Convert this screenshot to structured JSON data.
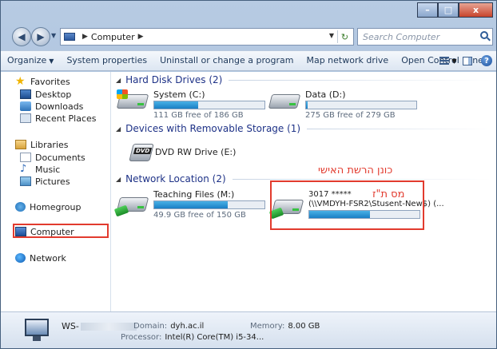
{
  "window": {
    "caption": {
      "minimize": "–",
      "maximize": "□",
      "close": "x"
    }
  },
  "address": {
    "path": [
      "Computer"
    ],
    "search_placeholder": "Search Computer"
  },
  "toolbar": {
    "organize": "Organize",
    "system_properties": "System properties",
    "uninstall": "Uninstall or change a program",
    "map_drive": "Map network drive",
    "control_panel": "Open Control Panel"
  },
  "nav": {
    "favorites": "Favorites",
    "desktop": "Desktop",
    "downloads": "Downloads",
    "recent": "Recent Places",
    "libraries": "Libraries",
    "documents": "Documents",
    "music": "Music",
    "pictures": "Pictures",
    "homegroup": "Homegroup",
    "computer": "Computer",
    "network": "Network"
  },
  "groups": {
    "hdd": "Hard Disk Drives (2)",
    "removable": "Devices with Removable Storage (1)",
    "network": "Network Location (2)"
  },
  "drives": {
    "system": {
      "name": "System (C:)",
      "free": "111 GB free of 186 GB",
      "used_fraction": 0.4
    },
    "data": {
      "name": "Data (D:)",
      "free": "275 GB free of 279 GB",
      "used_fraction": 0.015
    },
    "dvd": {
      "name": "DVD RW Drive (E:)",
      "badge": "DVD"
    },
    "teaching": {
      "name": "Teaching Files (M:)",
      "free": "49.9 GB free of 150 GB",
      "used_fraction": 0.67
    },
    "personal": {
      "line1": "3017 ***** ",
      "line2": "(\\\\VMDYH-FSR2\\Stusent-New$) (...",
      "used_fraction": 0.55
    }
  },
  "annotations": {
    "personal_drive": "כונן הרשת האישי",
    "id_number": "מס ת\"ז"
  },
  "details": {
    "name": "WS-",
    "domain_label": "Domain:",
    "domain_value": "dyh.ac.il",
    "memory_label": "Memory:",
    "memory_value": "8.00 GB",
    "processor_label": "Processor:",
    "processor_value": "Intel(R) Core(TM) i5-34..."
  }
}
